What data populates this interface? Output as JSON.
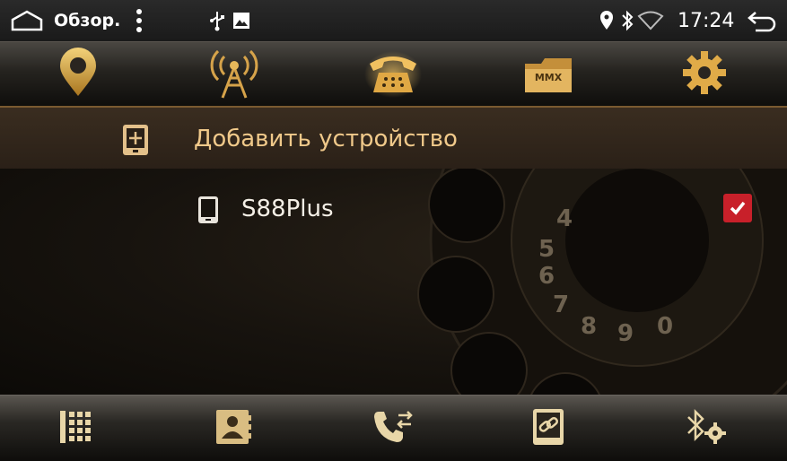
{
  "status_bar": {
    "title": "Обзор.",
    "time": "17:24",
    "icons": [
      "home-icon",
      "more-vert-icon",
      "usb-icon",
      "image-icon",
      "location-icon",
      "bluetooth-icon",
      "wifi-icon",
      "back-icon"
    ]
  },
  "top_nav": {
    "tabs": [
      {
        "name": "navigation",
        "icon": "location-pin-icon"
      },
      {
        "name": "radio",
        "icon": "antenna-icon"
      },
      {
        "name": "phone",
        "icon": "telephone-icon",
        "active": true
      },
      {
        "name": "media",
        "icon": "folder-icon",
        "label": "MMX"
      },
      {
        "name": "settings",
        "icon": "gear-icon"
      }
    ]
  },
  "add_device": {
    "label": "Добавить устройство",
    "icon": "add-device-icon"
  },
  "devices": [
    {
      "name": "S88Plus",
      "icon": "phone-device-icon",
      "checked": true
    }
  ],
  "bottom_nav": {
    "tabs": [
      {
        "name": "dialpad",
        "icon": "dialpad-icon"
      },
      {
        "name": "contacts",
        "icon": "contacts-icon"
      },
      {
        "name": "call-log",
        "icon": "call-log-icon"
      },
      {
        "name": "device-link",
        "icon": "link-icon"
      },
      {
        "name": "bt-settings",
        "icon": "bluetooth-settings-icon"
      }
    ]
  },
  "colors": {
    "accent_gold": "#d6a34a",
    "highlight_text": "#f0c98a",
    "checkbox_red": "#c8202a"
  }
}
